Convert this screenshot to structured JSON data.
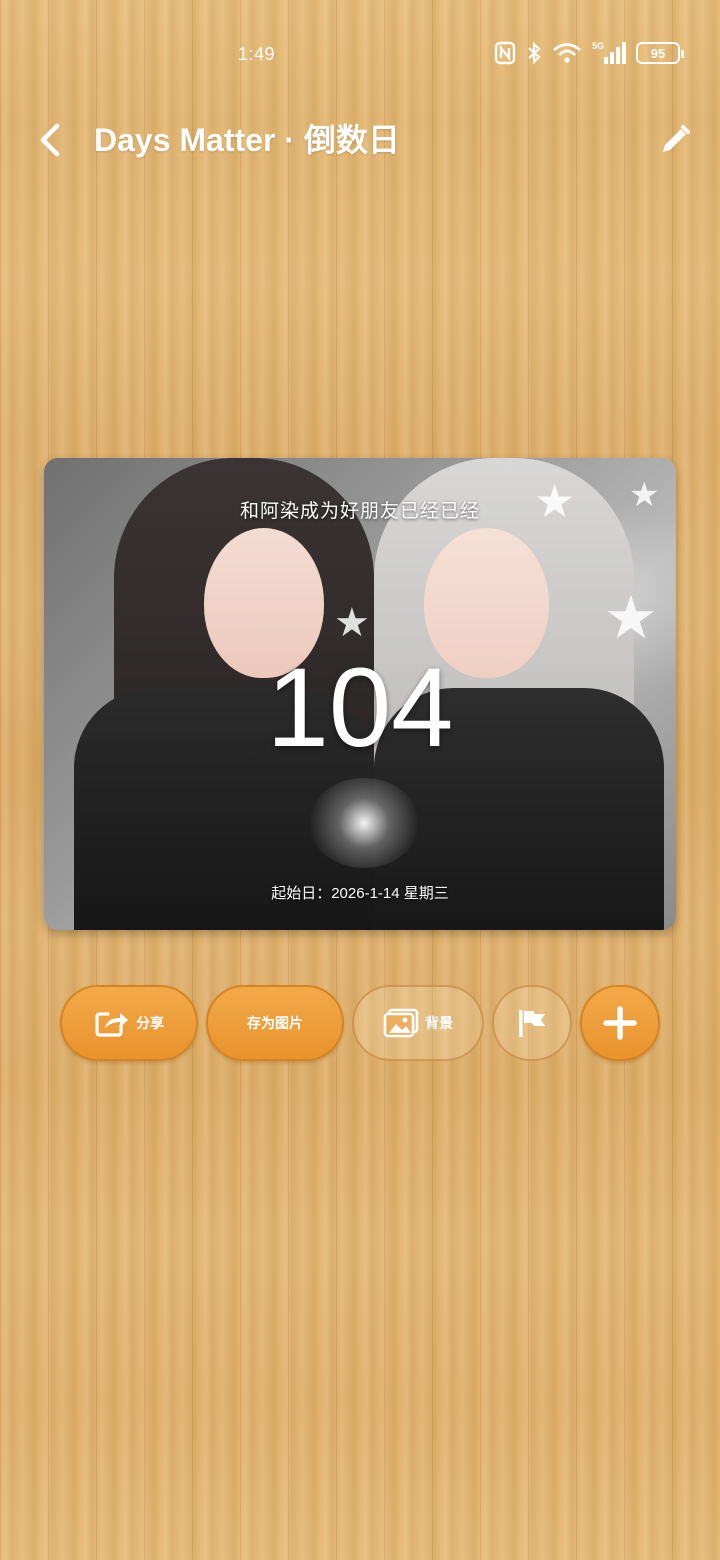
{
  "status_bar": {
    "time": "1:49",
    "battery": "95",
    "icons": [
      "nfc-icon",
      "bluetooth-icon",
      "wifi-icon",
      "signal-5g-icon",
      "battery-icon"
    ]
  },
  "header": {
    "title": "Days Matter · 倒数日"
  },
  "card": {
    "caption": "和阿染成为好朋友已经已经",
    "count": "104",
    "start_date": "起始日：2026-1-14  星期三"
  },
  "actions": {
    "share_label": "分享",
    "save_label": "存为图片",
    "background_label": "背景"
  },
  "colors": {
    "accent": "#eb9a35",
    "text": "#ffffff"
  }
}
